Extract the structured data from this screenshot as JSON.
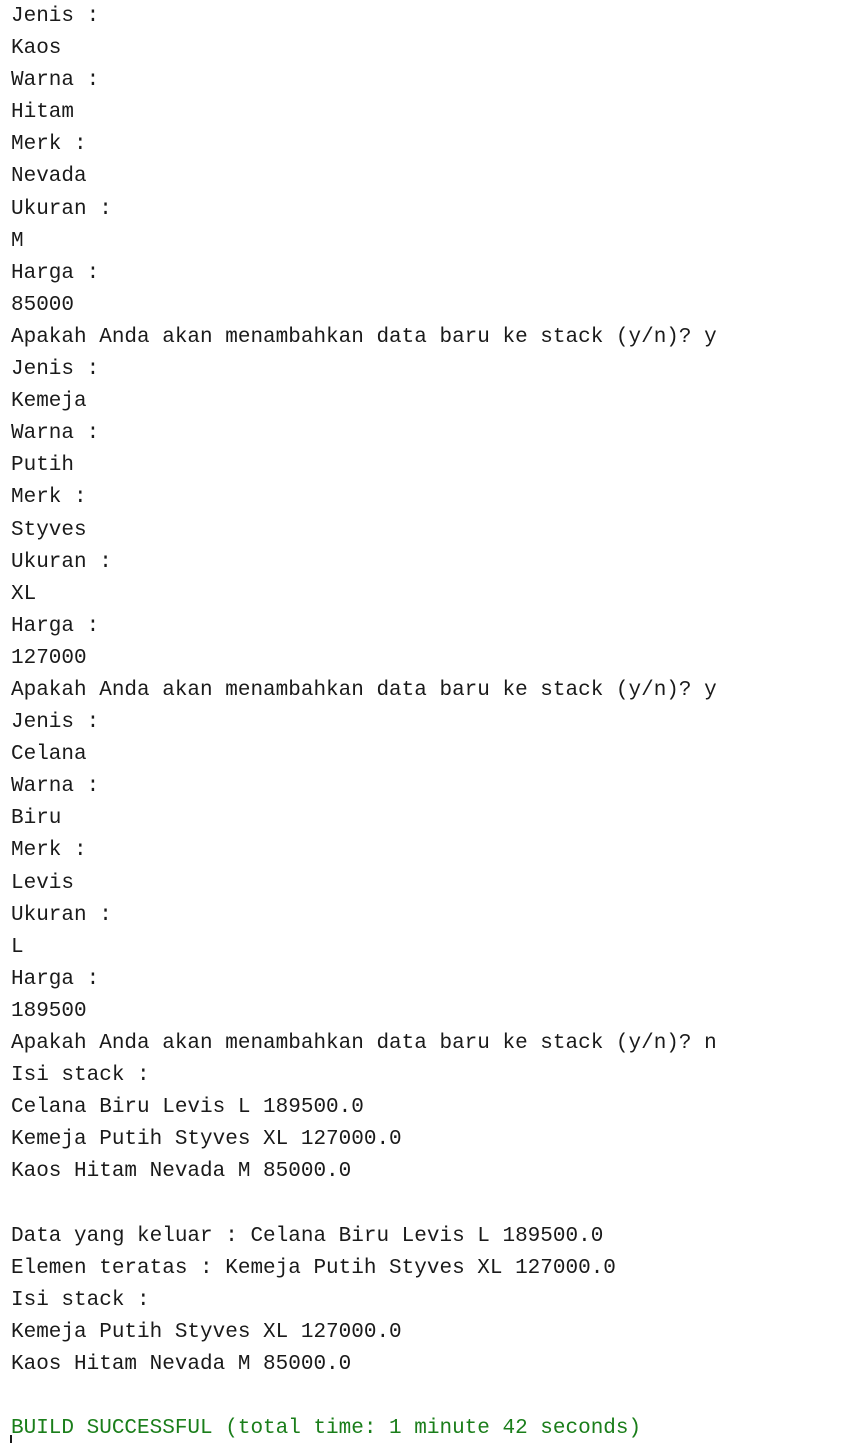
{
  "console": {
    "lines": [
      "Jenis :",
      "Kaos",
      "Warna :",
      "Hitam",
      "Merk :",
      "Nevada",
      "Ukuran :",
      "M",
      "Harga :",
      "85000",
      "Apakah Anda akan menambahkan data baru ke stack (y/n)? y",
      "Jenis :",
      "Kemeja",
      "Warna :",
      "Putih",
      "Merk :",
      "Styves",
      "Ukuran :",
      "XL",
      "Harga :",
      "127000",
      "Apakah Anda akan menambahkan data baru ke stack (y/n)? y",
      "Jenis :",
      "Celana",
      "Warna :",
      "Biru",
      "Merk :",
      "Levis",
      "Ukuran :",
      "L",
      "Harga :",
      "189500",
      "Apakah Anda akan menambahkan data baru ke stack (y/n)? n",
      "Isi stack :",
      "Celana Biru Levis L 189500.0",
      "Kemeja Putih Styves XL 127000.0",
      "Kaos Hitam Nevada M 85000.0",
      "",
      "Data yang keluar : Celana Biru Levis L 189500.0",
      "Elemen teratas : Kemeja Putih Styves XL 127000.0",
      "Isi stack :",
      "Kemeja Putih Styves XL 127000.0",
      "Kaos Hitam Nevada M 85000.0",
      "",
      "BUILD SUCCESSFUL (total time: 1 minute 42 seconds)"
    ]
  },
  "colors": {
    "text": "#1a1a1a",
    "success": "#1a7e1a",
    "background": "#ffffff"
  }
}
